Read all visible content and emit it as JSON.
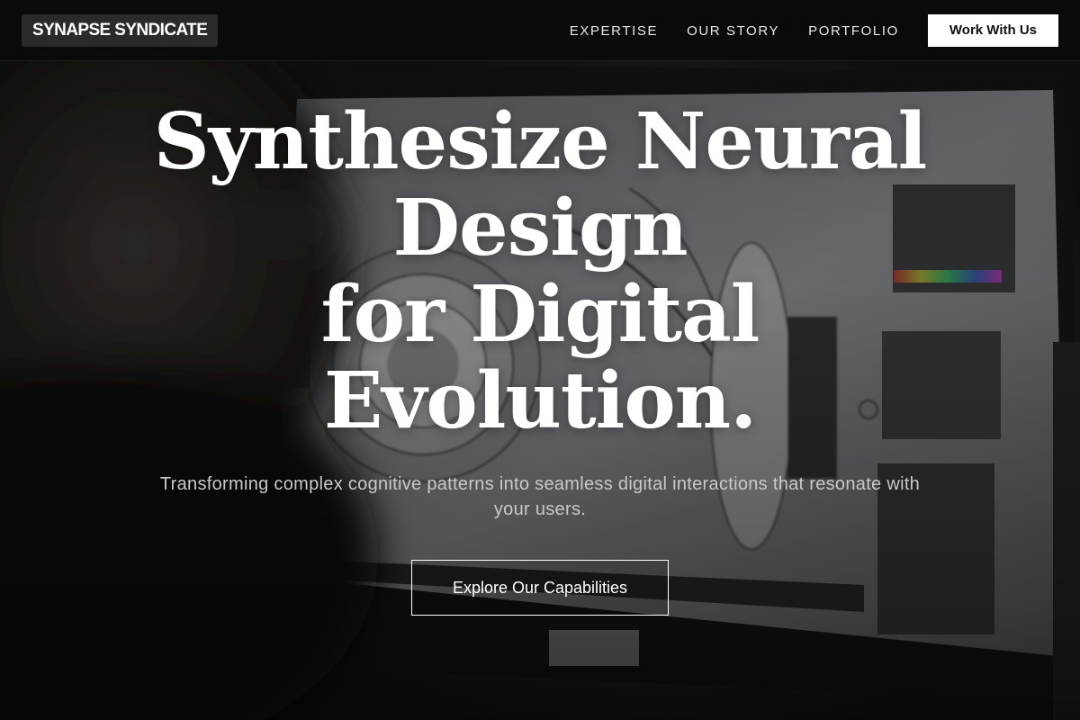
{
  "brand": {
    "name": "SYNAPSE SYNDICATE"
  },
  "nav": {
    "items": [
      {
        "label": "EXPERTISE"
      },
      {
        "label": "OUR STORY"
      },
      {
        "label": "PORTFOLIO"
      }
    ],
    "cta_label": "Work With Us"
  },
  "hero": {
    "title_lines": [
      "Synthesize Neural",
      "Design",
      "for Digital",
      "Evolution."
    ],
    "subtitle": "Transforming complex cognitive patterns into seamless digital interactions that resonate with your users.",
    "cta_label": "Explore Our Capabilities",
    "background_description_icon": "designer-monitor-photo"
  },
  "colors": {
    "header_bg": "#0a0a0a",
    "accent_button_bg": "#ffffff",
    "text_primary": "#ffffff",
    "text_secondary": "#c9c9c9"
  }
}
